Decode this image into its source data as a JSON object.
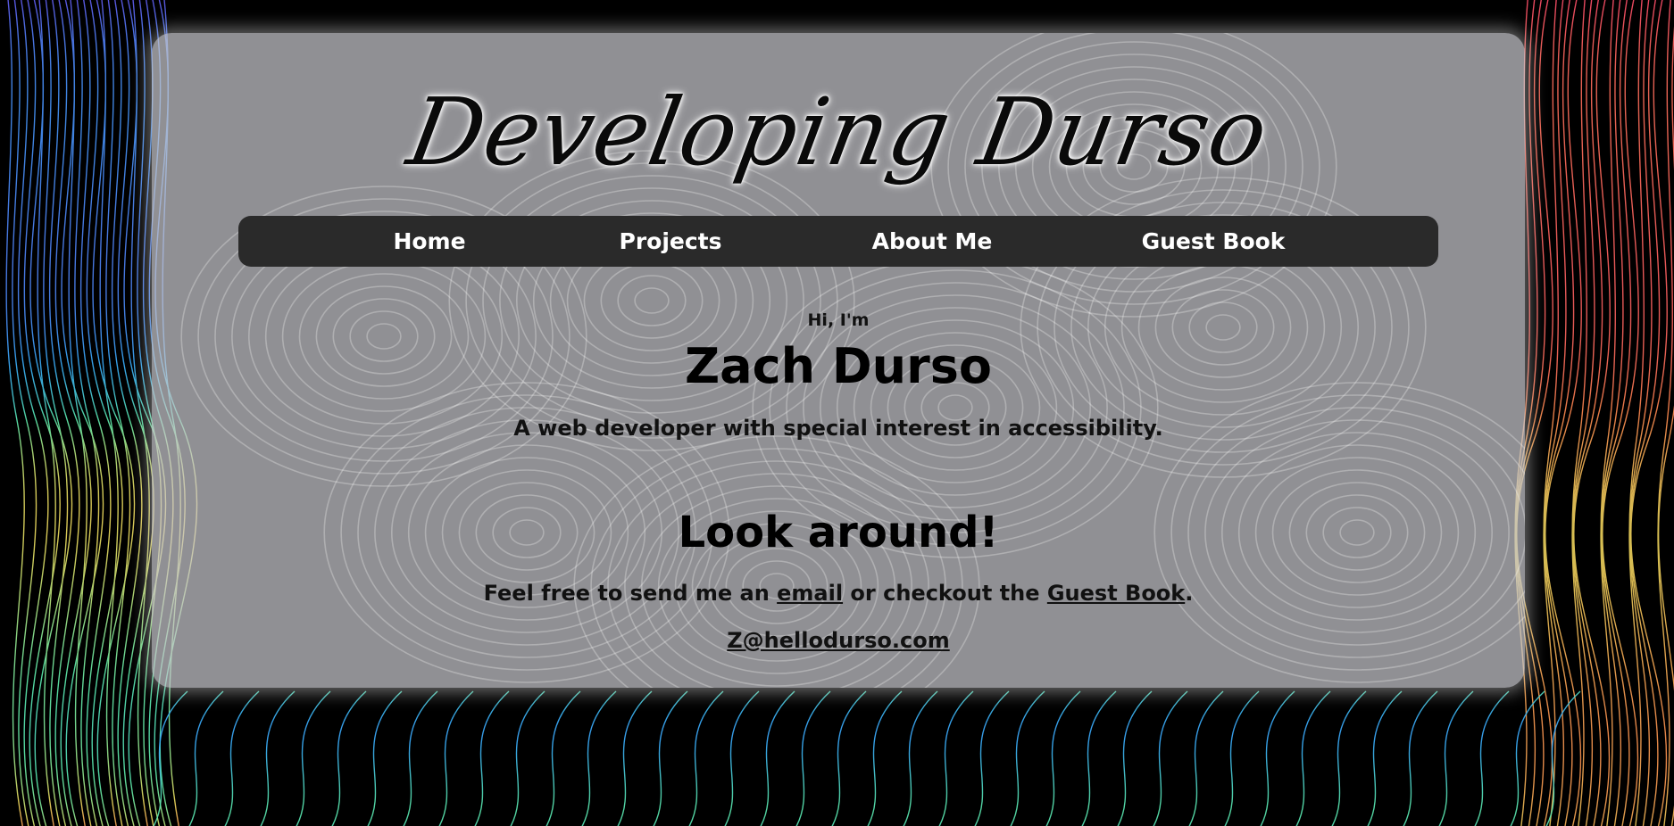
{
  "logo": {
    "text": "Developing Durso"
  },
  "nav": {
    "items": [
      {
        "label": "Home"
      },
      {
        "label": "Projects"
      },
      {
        "label": "About Me"
      },
      {
        "label": "Guest Book"
      }
    ]
  },
  "intro": {
    "greeting": "Hi, I'm",
    "name": "Zach Durso",
    "tagline": "A web developer with special interest in accessibility."
  },
  "cta": {
    "heading": "Look around!",
    "text_before": "Feel free to send me an ",
    "email_link": "email",
    "text_middle": " or checkout the ",
    "guestbook_link": "Guest Book",
    "text_after": ".",
    "email_address": "Z@hellodurso.com"
  },
  "colors": {
    "nav_bg": "#2a2a2a",
    "card_bg": "#c8c8cd",
    "page_bg": "#000000"
  }
}
